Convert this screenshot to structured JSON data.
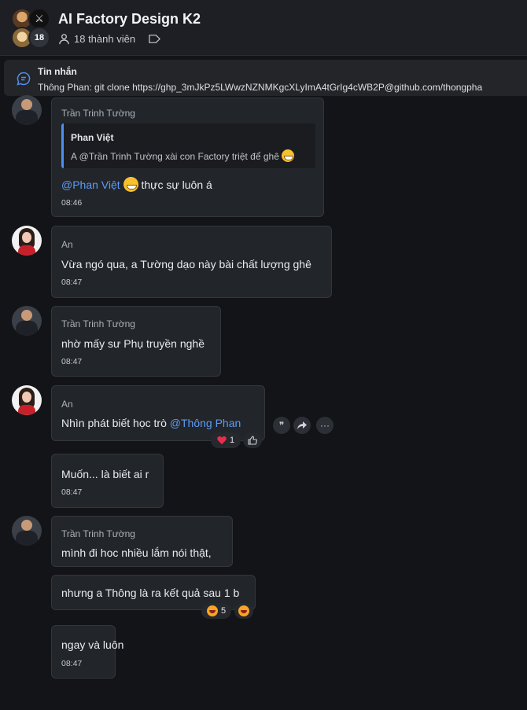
{
  "header": {
    "title": "AI Factory Design K2",
    "member_count": "18",
    "members_label": "18 thành viên"
  },
  "pinned": {
    "title": "Tin nhắn",
    "body": "Thông Phan: git clone https://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@github.com/thongpha"
  },
  "messages": [
    {
      "sender": "Trần Trinh Tường",
      "quote_name": "Phan Việt",
      "quote_text": "A @Trần Trinh Tường xài con Factory triệt để ghê",
      "mention": "@Phan Việt",
      "text": "thực sự luôn á",
      "time": "08:46"
    },
    {
      "sender": "An",
      "text": "Vừa ngó qua, a Tường dạo này bài chất lượng ghê",
      "time": "08:47"
    },
    {
      "sender": "Trần Trinh Tường",
      "text": "nhờ mấy sư Phụ truyền nghề",
      "time": "08:47"
    },
    {
      "sender": "An",
      "text": "Nhìn phát biết học trò",
      "mention": "@Thông Phan",
      "reaction_count": "1"
    },
    {
      "text": "Muốn... là biết ai r",
      "time": "08:47"
    },
    {
      "sender": "Trần Trinh Tường",
      "text": "mình đi hoc nhiều lắm nói thật,"
    },
    {
      "text": "nhưng a Thông là ra kết quả sau 1 b",
      "reaction_count": "5"
    },
    {
      "text": "ngay và luôn",
      "time": "08:47"
    }
  ]
}
